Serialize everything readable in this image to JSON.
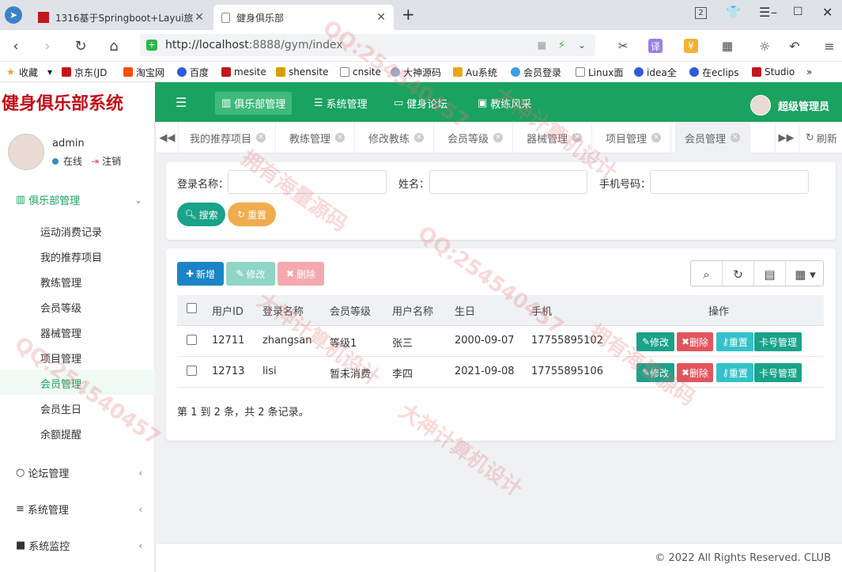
{
  "browser": {
    "tabs": [
      {
        "title": "1316基于Springboot+Layui旅",
        "active": false
      },
      {
        "title": "健身俱乐部",
        "active": true
      }
    ],
    "tab_count": "2",
    "url_host": "http://localhost",
    "url_path": ":8888/gym/index",
    "bookmarks": [
      "收藏",
      "京东(JD",
      "淘宝网",
      "百度",
      "mesite",
      "shensite",
      "cnsite",
      "大神源码",
      "Au系统",
      "会员登录",
      "Linux面",
      "idea全",
      "在eclips",
      "Studio"
    ]
  },
  "app": {
    "logo": "健身俱乐部系统",
    "topnav": [
      "俱乐部管理",
      "系统管理",
      "健身论坛",
      "教练风采"
    ],
    "user_role": "超级管理员",
    "accent": "#1aa260"
  },
  "sidebar": {
    "username": "admin",
    "status": "在线",
    "logout": "注销",
    "group_active": "俱乐部管理",
    "items": [
      "运动消费记录",
      "我的推荐项目",
      "教练管理",
      "会员等级",
      "器械管理",
      "项目管理",
      "会员管理",
      "会员生日",
      "余额提醒"
    ],
    "active_item": "会员管理",
    "groups": [
      "论坛管理",
      "系统管理",
      "系统监控"
    ]
  },
  "page_tabs": [
    "我的推荐项目",
    "教练管理",
    "修改教练",
    "会员等级",
    "器械管理",
    "项目管理",
    "会员管理"
  ],
  "refresh": "刷新",
  "search": {
    "login_label": "登录名称：",
    "name_label": "姓名：",
    "phone_label": "手机号码：",
    "search_btn": "搜索",
    "reset_btn": "重置"
  },
  "toolbar": {
    "add": "新增",
    "edit": "修改",
    "delete": "删除"
  },
  "table": {
    "columns": [
      "用户ID",
      "登录名称",
      "会员等级",
      "用户名称",
      "生日",
      "手机",
      "操作"
    ],
    "rows": [
      {
        "id": "12711",
        "login": "zhangsan",
        "level": "等级1",
        "name": "张三",
        "birthday": "2000-09-07",
        "phone": "17755895102"
      },
      {
        "id": "12713",
        "login": "lisi",
        "level": "暂未消费",
        "name": "李四",
        "birthday": "2021-09-08",
        "phone": "17755895106"
      }
    ],
    "actions": {
      "edit": "修改",
      "delete": "删除",
      "reset": "重置",
      "card": "卡号管理"
    },
    "summary": "第 1 到 2 条，共 2 条记录。"
  },
  "footer": "© 2022 All Rights Reserved. CLUB",
  "watermarks": [
    "大神计算机设计",
    "QQ:254540457",
    "拥有海量源码"
  ]
}
